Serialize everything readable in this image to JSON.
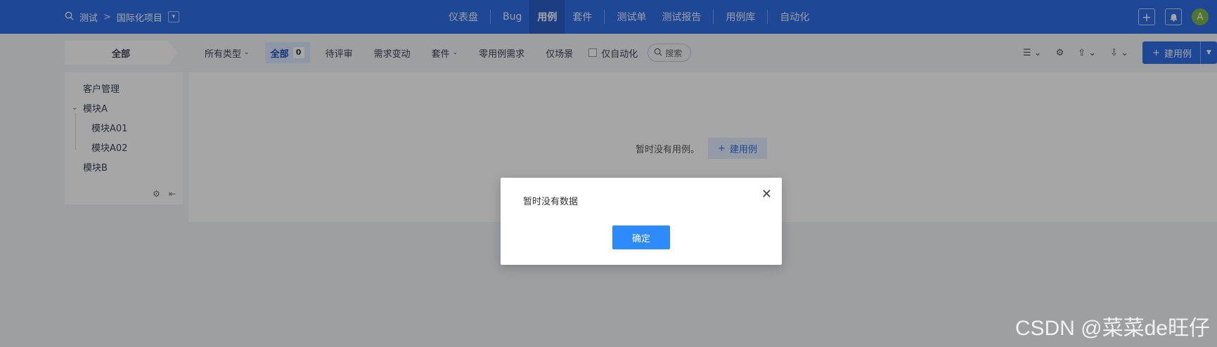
{
  "topbar": {
    "breadcrumb": {
      "root": "测试",
      "separator": ">",
      "project": "国际化项目"
    },
    "nav": [
      "仪表盘",
      "Bug",
      "用例",
      "套件",
      "测试单",
      "测试报告",
      "用例库",
      "自动化"
    ],
    "active_nav": "用例",
    "avatar_letter": "A"
  },
  "toolbar": {
    "all_label": "全部",
    "type_filter": "所有类型",
    "tabs": {
      "all": "全部",
      "all_count": "0",
      "pending_review": "待评审",
      "requirement_change": "需求变动",
      "suite": "套件",
      "zero_case_requirement": "零用例需求",
      "scene_only": "仅场景",
      "auto_only": "仅自动化"
    },
    "search_placeholder": "搜索",
    "new_case": "建用例"
  },
  "tree": {
    "nodes": [
      {
        "label": "客户管理"
      },
      {
        "label": "模块A"
      },
      {
        "label": "模块A01"
      },
      {
        "label": "模块A02"
      },
      {
        "label": "模块B"
      }
    ]
  },
  "empty": {
    "message": "暂时没有用例。",
    "button": "建用例"
  },
  "dialog": {
    "message": "暂时没有数据",
    "ok": "确定"
  },
  "watermark": "CSDN @菜菜de旺仔",
  "colors": {
    "primary": "#2e6fe6",
    "dialog_button": "#2e8bff"
  }
}
